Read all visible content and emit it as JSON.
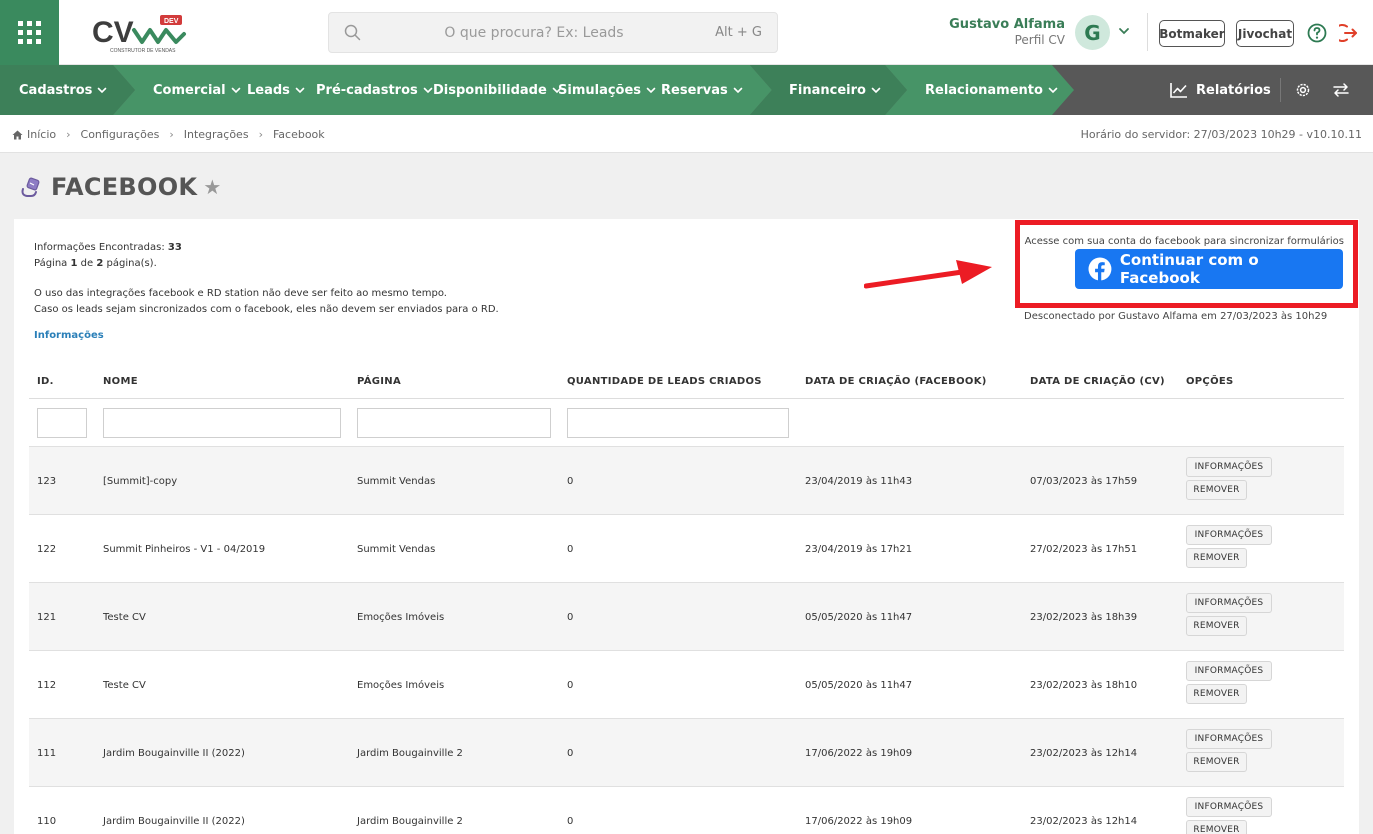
{
  "header": {
    "logo_text": "CV",
    "logo_badge": "DEV",
    "logo_subtitle": "CONSTRUTOR DE VENDAS",
    "search_placeholder": "O que procura? Ex: Leads",
    "search_shortcut": "Alt + G",
    "user_name": "Gustavo Alfama",
    "user_role": "Perfil CV",
    "avatar_initial": "G",
    "botmaker_label": "Botmaker",
    "jivochat_label": "Jivochat"
  },
  "nav": {
    "items": [
      {
        "label": "Cadastros"
      },
      {
        "label": "Comercial"
      },
      {
        "label": "Leads"
      },
      {
        "label": "Pré-cadastros"
      },
      {
        "label": "Disponibilidade"
      },
      {
        "label": "Simulações"
      },
      {
        "label": "Reservas"
      },
      {
        "label": "Financeiro"
      },
      {
        "label": "Relacionamento"
      }
    ],
    "reports_label": "Relatórios",
    "colors": {
      "dark_green": "#3d8059",
      "mid_green": "#479467",
      "gray": "#585858"
    }
  },
  "breadcrumb": {
    "items": [
      "Início",
      "Configurações",
      "Integrações",
      "Facebook"
    ],
    "server_time": "Horário do servidor: 27/03/2023 10h29 - v10.10.11"
  },
  "page": {
    "title": "FACEBOOK"
  },
  "info": {
    "found_label": "Informações Encontradas:",
    "found_count": "33",
    "page_word": "Página",
    "page_current": "1",
    "page_of": "de",
    "page_total": "2",
    "page_suffix": "página(s).",
    "warning_1": "O uso das integrações facebook e RD station não deve ser feito ao mesmo tempo.",
    "warning_2": "Caso os leads sejam sincronizados com o facebook, eles não devem ser enviados para o RD.",
    "info_link": "Informações"
  },
  "facebook": {
    "note": "Acesse com sua conta do facebook para sincronizar formulários",
    "button_label": "Continuar com o Facebook",
    "disconnected": "Desconectado por Gustavo Alfama em 27/03/2023 às 10h29",
    "brand_color": "#1877f2",
    "highlight_color": "#ec1c24"
  },
  "table": {
    "headers": {
      "id": "ID.",
      "name": "NOME",
      "page": "PÁGINA",
      "leads": "QUANTIDADE DE LEADS CRIADOS",
      "fb_date": "DATA DE CRIAÇÃO (FACEBOOK)",
      "cv_date": "DATA DE CRIAÇÃO (CV)",
      "options": "OPÇÕES"
    },
    "info_btn": "INFORMAÇÕES",
    "remove_btn": "REMOVER",
    "rows": [
      {
        "id": "123",
        "name": "[Summit]-copy",
        "page": "Summit Vendas",
        "leads": "0",
        "fb_date": "23/04/2019 às 11h43",
        "cv_date": "07/03/2023 às 17h59"
      },
      {
        "id": "122",
        "name": "Summit Pinheiros - V1 - 04/2019",
        "page": "Summit Vendas",
        "leads": "0",
        "fb_date": "23/04/2019 às 17h21",
        "cv_date": "27/02/2023 às 17h51"
      },
      {
        "id": "121",
        "name": "Teste CV",
        "page": "Emoções Imóveis",
        "leads": "0",
        "fb_date": "05/05/2020 às 11h47",
        "cv_date": "23/02/2023 às 18h39"
      },
      {
        "id": "112",
        "name": "Teste CV",
        "page": "Emoções Imóveis",
        "leads": "0",
        "fb_date": "05/05/2020 às 11h47",
        "cv_date": "23/02/2023 às 18h10"
      },
      {
        "id": "111",
        "name": "Jardim Bougainville II (2022)",
        "page": "Jardim Bougainville 2",
        "leads": "0",
        "fb_date": "17/06/2022 às 19h09",
        "cv_date": "23/02/2023 às 12h14"
      },
      {
        "id": "110",
        "name": "Jardim Bougainville II (2022)",
        "page": "Jardim Bougainville 2",
        "leads": "0",
        "fb_date": "17/06/2022 às 19h09",
        "cv_date": "23/02/2023 às 12h14"
      }
    ]
  }
}
